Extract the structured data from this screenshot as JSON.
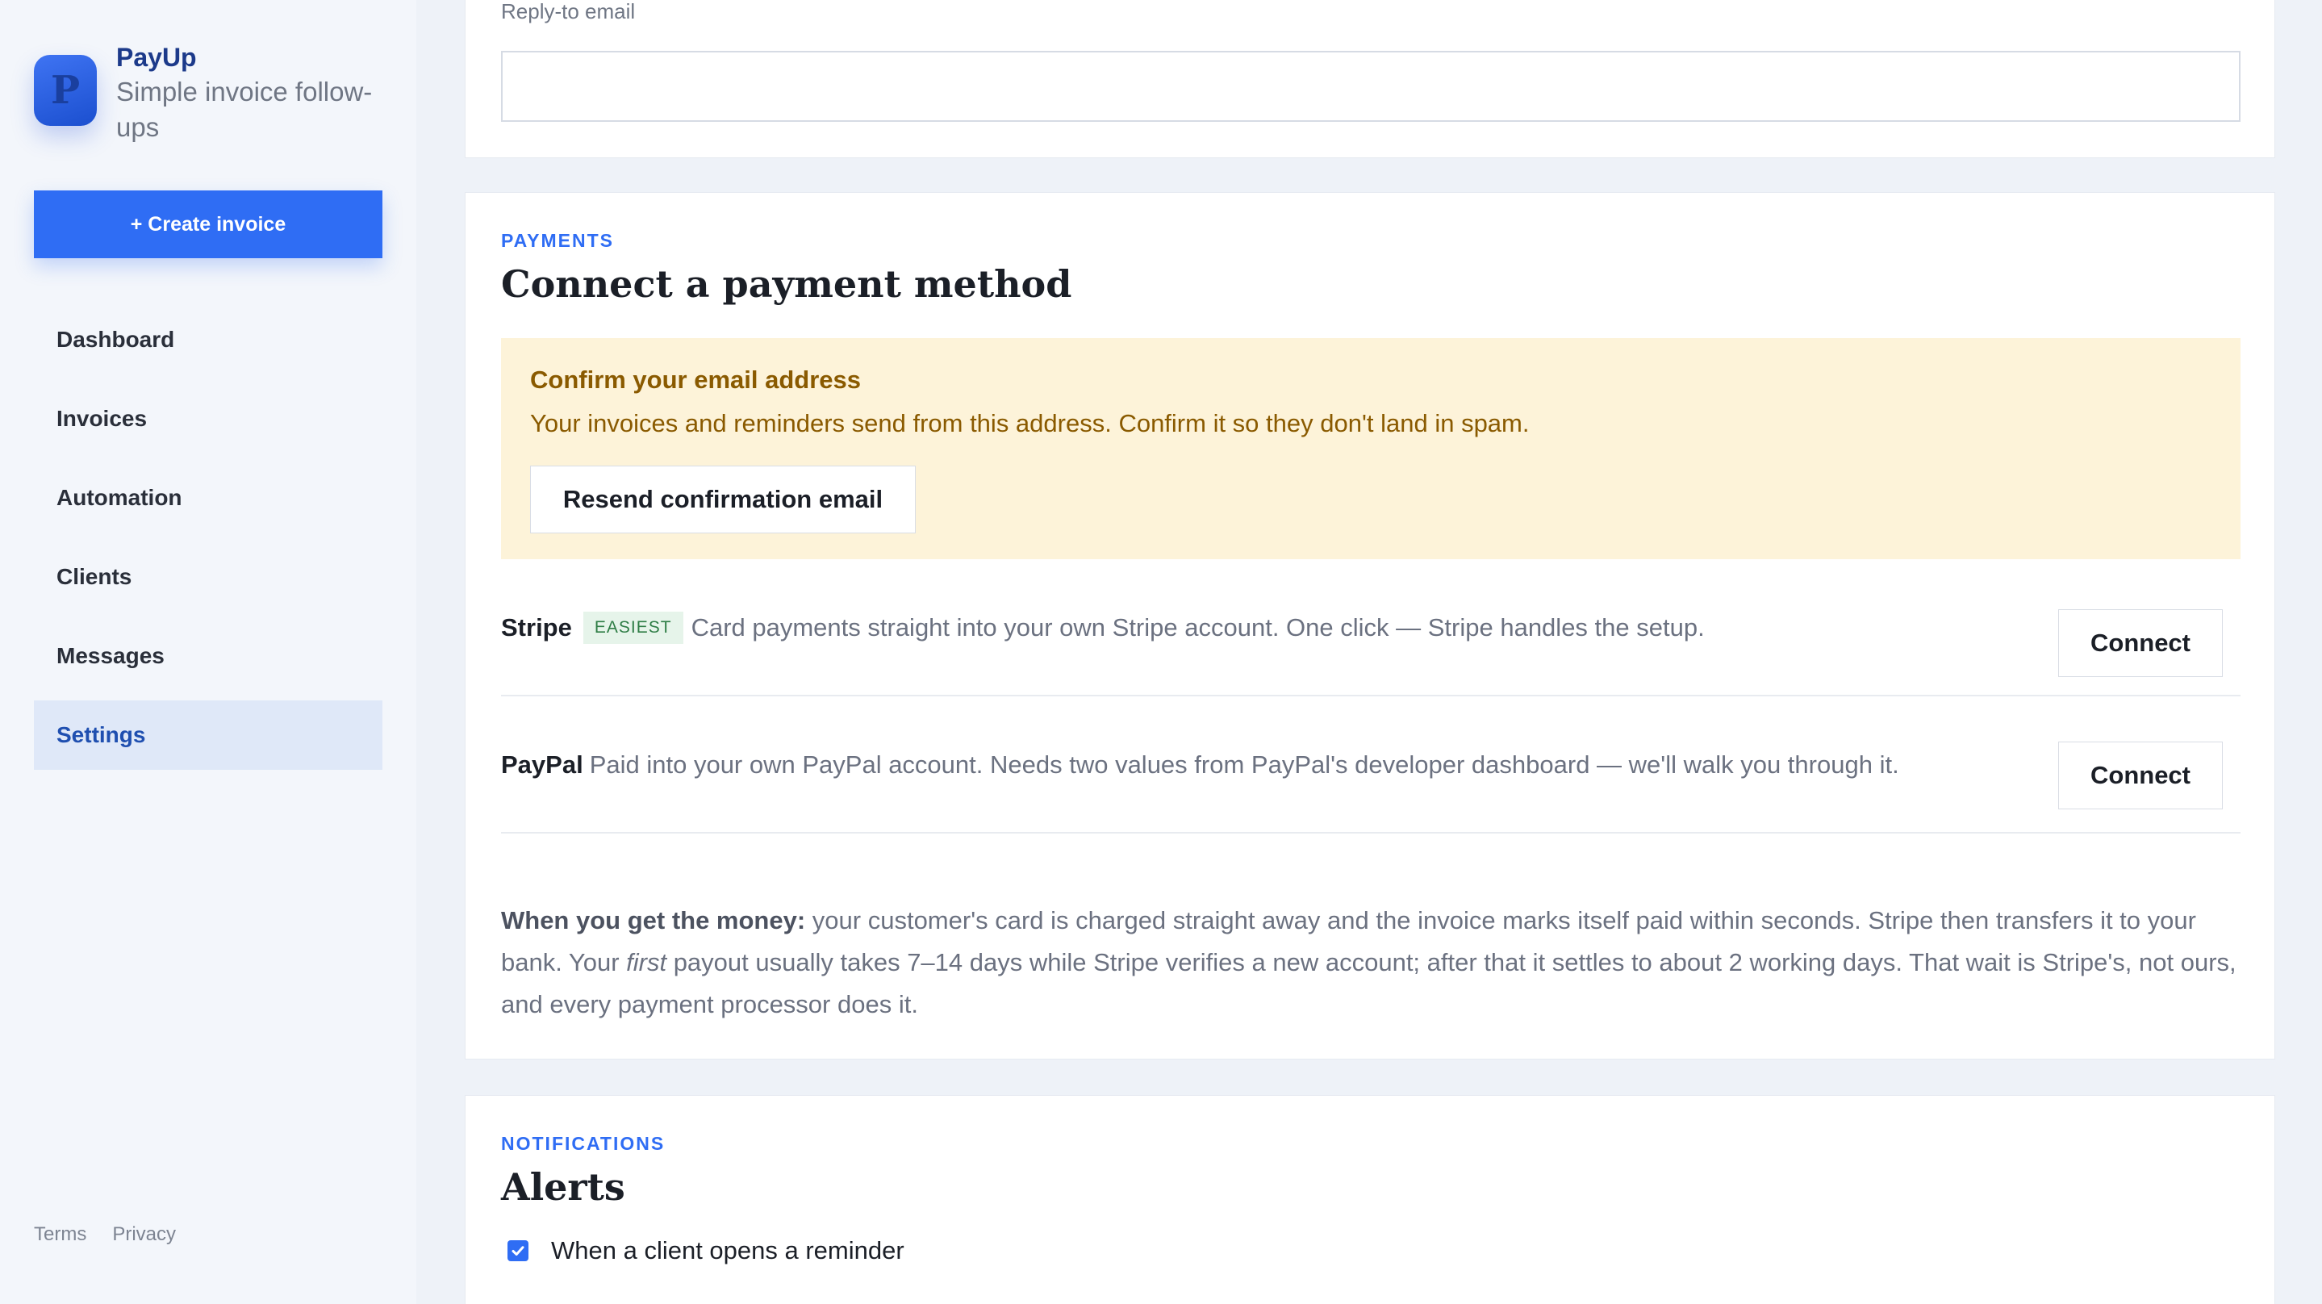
{
  "sidebar": {
    "brand_initial": "P",
    "brand_name": "PayUp",
    "brand_tagline": "Simple invoice follow-ups",
    "create_button": "+ Create invoice",
    "nav": [
      {
        "label": "Dashboard",
        "active": false
      },
      {
        "label": "Invoices",
        "active": false
      },
      {
        "label": "Automation",
        "active": false
      },
      {
        "label": "Clients",
        "active": false
      },
      {
        "label": "Messages",
        "active": false
      },
      {
        "label": "Settings",
        "active": true
      }
    ],
    "footer": {
      "terms": "Terms",
      "privacy": "Privacy"
    }
  },
  "reply_to": {
    "label": "Reply-to email",
    "value": ""
  },
  "payments": {
    "eyebrow": "PAYMENTS",
    "title": "Connect a payment method",
    "notice": {
      "title": "Confirm your email address",
      "body": "Your invoices and reminders send from this address. Confirm it so they don't land in spam.",
      "button": "Resend confirmation email"
    },
    "providers": [
      {
        "name": "Stripe",
        "badge": "EASIEST",
        "description": "Card payments straight into your own Stripe account. One click — Stripe handles the setup.",
        "button": "Connect"
      },
      {
        "name": "PayPal",
        "badge": "",
        "description": "Paid into your own PayPal account. Needs two values from PayPal's developer dashboard — we'll walk you through it.",
        "button": "Connect"
      }
    ],
    "money_note": {
      "lead": "When you get the money:",
      "part1": " your customer's card is charged straight away and the invoice marks itself paid within seconds. Stripe then transfers it to your bank. Your ",
      "emphasis": "first",
      "part2": " payout usually takes 7–14 days while Stripe verifies a new account; after that it settles to about 2 working days. That wait is Stripe's, not ours, and every payment processor does it."
    }
  },
  "notifications": {
    "eyebrow": "NOTIFICATIONS",
    "title": "Alerts",
    "items": [
      {
        "label": "When a client opens a reminder",
        "checked": true
      }
    ]
  },
  "colors": {
    "accent": "#2f6df4",
    "notice_bg": "#fdf3d9",
    "notice_text": "#8a5a00",
    "badge_bg": "#e6f4ea",
    "badge_text": "#2e7d45"
  }
}
